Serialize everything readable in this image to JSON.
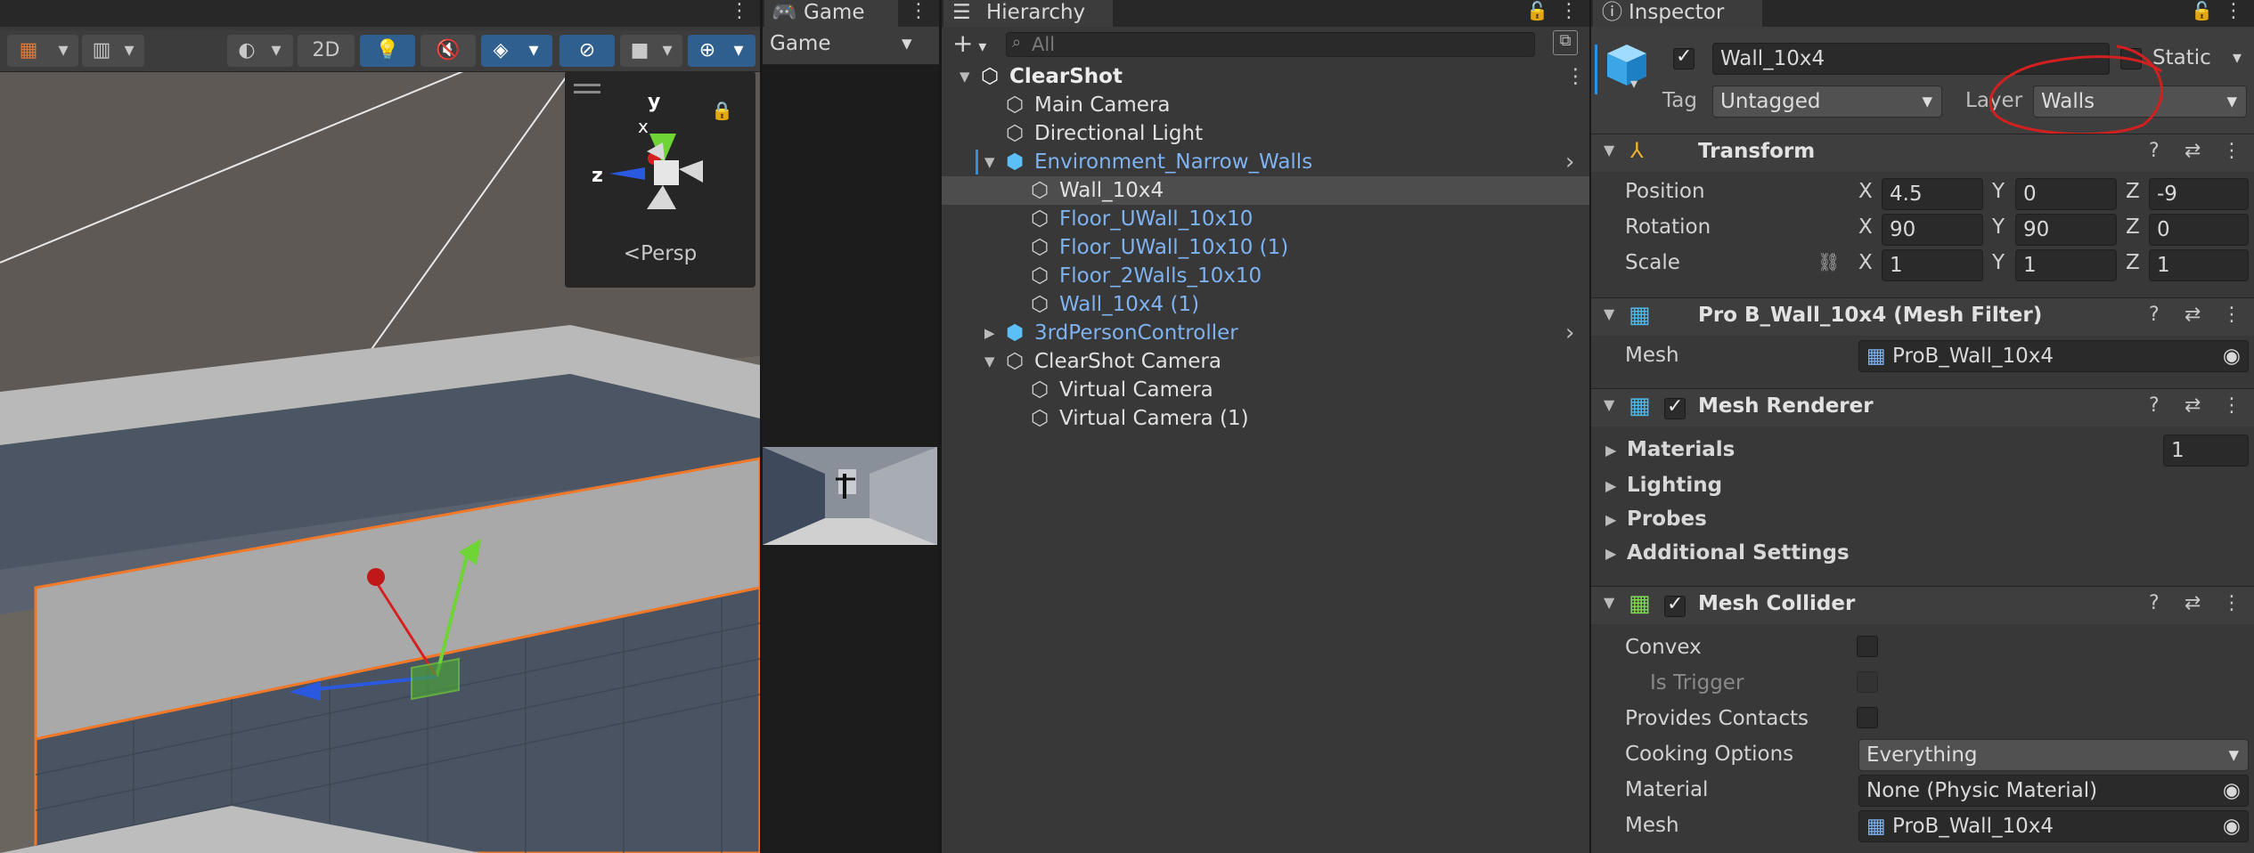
{
  "scene": {
    "toolbar": {
      "mode_2d": "2D"
    },
    "persp_label": "Persp",
    "axis_labels": {
      "y": "y",
      "x": "x",
      "z": "z"
    }
  },
  "game": {
    "tab_label": "Game",
    "display_dropdown": "Game"
  },
  "hierarchy": {
    "tab_label": "Hierarchy",
    "search_placeholder": "All",
    "rows": [
      {
        "label": "ClearShot",
        "style": "bold"
      },
      {
        "label": "Main Camera",
        "style": "white"
      },
      {
        "label": "Directional Light",
        "style": "white"
      },
      {
        "label": "Environment_Narrow_Walls",
        "style": "blue"
      },
      {
        "label": "Wall_10x4",
        "style": "white"
      },
      {
        "label": "Floor_UWall_10x10",
        "style": "blue"
      },
      {
        "label": "Floor_UWall_10x10 (1)",
        "style": "blue"
      },
      {
        "label": "Floor_2Walls_10x10",
        "style": "blue"
      },
      {
        "label": "Wall_10x4 (1)",
        "style": "blue"
      },
      {
        "label": "3rdPersonController",
        "style": "blue"
      },
      {
        "label": "ClearShot Camera",
        "style": "white"
      },
      {
        "label": "Virtual Camera",
        "style": "white"
      },
      {
        "label": "Virtual Camera (1)",
        "style": "white"
      }
    ]
  },
  "inspector": {
    "tab_label": "Inspector",
    "object_name": "Wall_10x4",
    "static_label": "Static",
    "tag_label": "Tag",
    "tag_value": "Untagged",
    "layer_label": "Layer",
    "layer_value": "Walls",
    "transform": {
      "title": "Transform",
      "position_label": "Position",
      "rotation_label": "Rotation",
      "scale_label": "Scale",
      "axis_x": "X",
      "axis_y": "Y",
      "axis_z": "Z",
      "position": {
        "x": "4.5",
        "y": "0",
        "z": "-9"
      },
      "rotation": {
        "x": "90",
        "y": "90",
        "z": "0"
      },
      "scale": {
        "x": "1",
        "y": "1",
        "z": "1"
      }
    },
    "mesh_filter": {
      "title": "Pro B_Wall_10x4 (Mesh Filter)",
      "mesh_label": "Mesh",
      "mesh_value": "ProB_Wall_10x4"
    },
    "mesh_renderer": {
      "title": "Mesh Renderer",
      "materials_label": "Materials",
      "materials_count": "1",
      "lighting_label": "Lighting",
      "probes_label": "Probes",
      "additional_label": "Additional Settings"
    },
    "mesh_collider": {
      "title": "Mesh Collider",
      "convex_label": "Convex",
      "is_trigger_label": "Is Trigger",
      "provides_contacts_label": "Provides Contacts",
      "cooking_options_label": "Cooking Options",
      "cooking_options_value": "Everything",
      "material_label": "Material",
      "material_value": "None (Physic Material)",
      "mesh_label": "Mesh",
      "mesh_value": "ProB_Wall_10x4"
    }
  },
  "colors": {
    "accent_blue": "#7eb2f0",
    "annotation_red": "#d22020",
    "selection_orange": "#f07828"
  }
}
